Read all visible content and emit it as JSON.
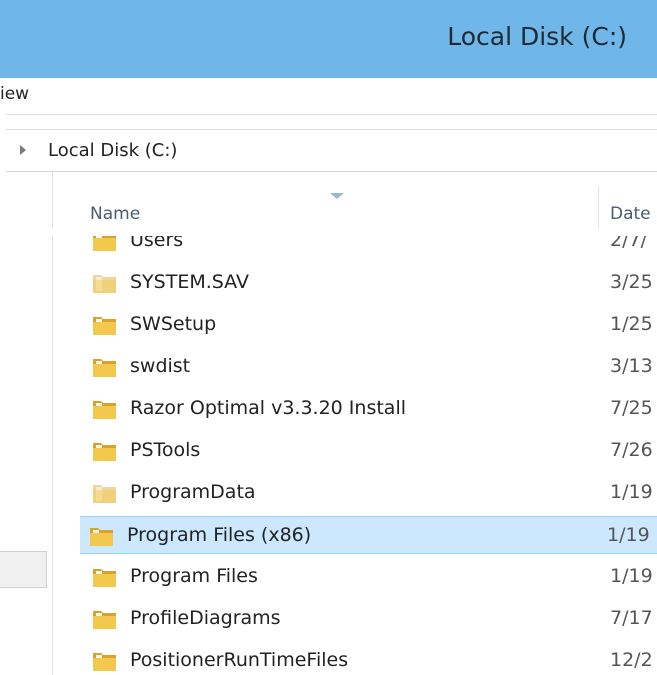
{
  "window": {
    "title": "Local Disk (C:)"
  },
  "ribbon": {
    "tab_partial": "iew"
  },
  "address": {
    "crumb": "Local Disk (C:)"
  },
  "columns": {
    "name": "Name",
    "date": "Date"
  },
  "rows": [
    {
      "name": "Users",
      "date": "2/7/",
      "faded": false
    },
    {
      "name": "SYSTEM.SAV",
      "date": "3/25",
      "faded": true
    },
    {
      "name": "SWSetup",
      "date": "1/25",
      "faded": false
    },
    {
      "name": "swdist",
      "date": "3/13",
      "faded": false
    },
    {
      "name": "Razor Optimal v3.3.20 Install",
      "date": "7/25",
      "faded": false
    },
    {
      "name": "PSTools",
      "date": "7/26",
      "faded": false
    },
    {
      "name": "ProgramData",
      "date": "1/19",
      "faded": true
    },
    {
      "name": "Program Files (x86)",
      "date": "1/19",
      "faded": false,
      "selected": true
    },
    {
      "name": "Program Files",
      "date": "1/19",
      "faded": false
    },
    {
      "name": "ProfileDiagrams",
      "date": "7/17",
      "faded": false
    },
    {
      "name": "PositionerRunTimeFiles",
      "date": "12/2",
      "faded": false
    }
  ],
  "icons": {
    "folder": "folder-icon",
    "expand": "chevron-right-icon",
    "sort": "sort-descending-icon"
  },
  "colors": {
    "titlebar": "#6fb7e8",
    "selection": "#cce8ff",
    "selection_border": "#99d1ff",
    "folder": "#e8b93c"
  }
}
